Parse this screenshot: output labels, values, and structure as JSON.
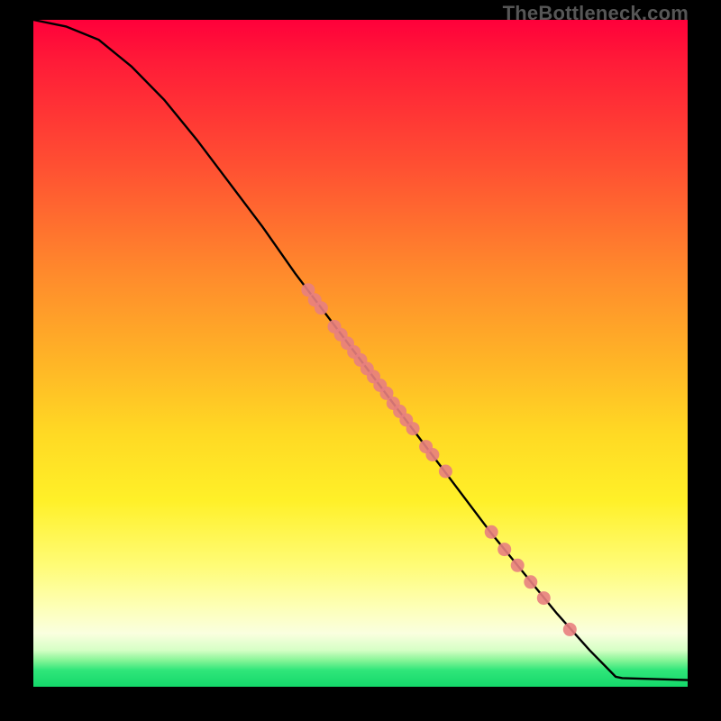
{
  "watermark": "TheBottleneck.com",
  "chart_data": {
    "type": "line",
    "title": "",
    "xlabel": "",
    "ylabel": "",
    "xlim": [
      0,
      100
    ],
    "ylim": [
      0,
      100
    ],
    "grid": false,
    "curve": [
      {
        "x": 0,
        "y": 100
      },
      {
        "x": 5,
        "y": 99
      },
      {
        "x": 10,
        "y": 97
      },
      {
        "x": 15,
        "y": 93
      },
      {
        "x": 20,
        "y": 88
      },
      {
        "x": 25,
        "y": 82
      },
      {
        "x": 30,
        "y": 75.5
      },
      {
        "x": 35,
        "y": 69
      },
      {
        "x": 40,
        "y": 62
      },
      {
        "x": 45,
        "y": 55.5
      },
      {
        "x": 50,
        "y": 49
      },
      {
        "x": 55,
        "y": 42.5
      },
      {
        "x": 60,
        "y": 36
      },
      {
        "x": 65,
        "y": 29.5
      },
      {
        "x": 70,
        "y": 23
      },
      {
        "x": 75,
        "y": 17
      },
      {
        "x": 80,
        "y": 11
      },
      {
        "x": 85,
        "y": 5.5
      },
      {
        "x": 89,
        "y": 1.5
      },
      {
        "x": 90,
        "y": 1.3
      },
      {
        "x": 100,
        "y": 1.0
      }
    ],
    "points": [
      {
        "x": 42,
        "y": 59.5
      },
      {
        "x": 43,
        "y": 58
      },
      {
        "x": 44,
        "y": 56.8
      },
      {
        "x": 46,
        "y": 54
      },
      {
        "x": 47,
        "y": 52.8
      },
      {
        "x": 48,
        "y": 51.5
      },
      {
        "x": 49,
        "y": 50.2
      },
      {
        "x": 50,
        "y": 49
      },
      {
        "x": 51,
        "y": 47.7
      },
      {
        "x": 52,
        "y": 46.5
      },
      {
        "x": 53,
        "y": 45.2
      },
      {
        "x": 54,
        "y": 44
      },
      {
        "x": 55,
        "y": 42.5
      },
      {
        "x": 56,
        "y": 41.3
      },
      {
        "x": 57,
        "y": 40
      },
      {
        "x": 58,
        "y": 38.7
      },
      {
        "x": 60,
        "y": 36
      },
      {
        "x": 61,
        "y": 34.8
      },
      {
        "x": 63,
        "y": 32.3
      },
      {
        "x": 70,
        "y": 23.2
      },
      {
        "x": 72,
        "y": 20.6
      },
      {
        "x": 74,
        "y": 18.2
      },
      {
        "x": 76,
        "y": 15.7
      },
      {
        "x": 78,
        "y": 13.3
      },
      {
        "x": 82,
        "y": 8.6
      }
    ],
    "point_color": "#e88080",
    "curve_color": "#000000"
  }
}
